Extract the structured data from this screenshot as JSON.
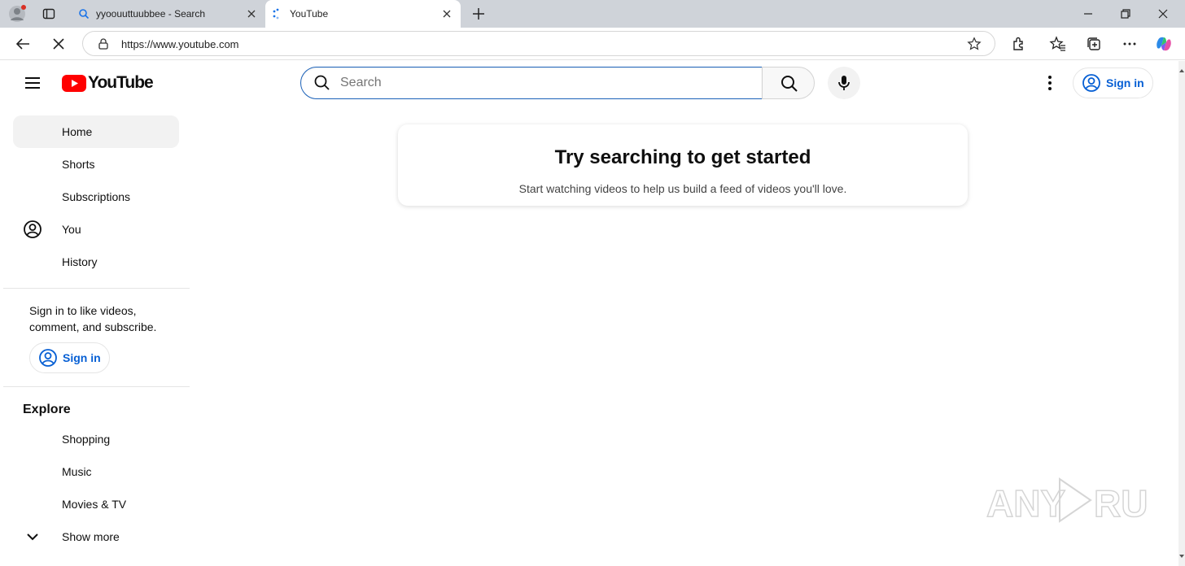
{
  "browser": {
    "tabs": [
      {
        "title": "yyoouuttuubbee - Search",
        "icon": "search-icon"
      },
      {
        "title": "YouTube",
        "icon": "loading-icon",
        "active": true
      }
    ],
    "url": "https://www.youtube.com"
  },
  "youtube": {
    "logo_text": "YouTube",
    "search_placeholder": "Search",
    "sign_in_label": "Sign in",
    "sidebar": {
      "main_items": [
        {
          "label": "Home",
          "active": true
        },
        {
          "label": "Shorts"
        },
        {
          "label": "Subscriptions"
        },
        {
          "label": "You",
          "icon": "account-circle-icon"
        },
        {
          "label": "History"
        }
      ],
      "sign_in_prompt_line1": "Sign in to like videos,",
      "sign_in_prompt_line2": "comment, and subscribe.",
      "sign_in_button": "Sign in",
      "explore_heading": "Explore",
      "explore_items": [
        {
          "label": "Shopping"
        },
        {
          "label": "Music"
        },
        {
          "label": "Movies & TV"
        },
        {
          "label": "Show more",
          "icon": "chevron-down-icon"
        }
      ]
    },
    "empty_state": {
      "title": "Try searching to get started",
      "subtitle": "Start watching videos to help us build a feed of videos you'll love."
    }
  },
  "watermark": "ANY RUN",
  "colors": {
    "brand_red": "#ff0000",
    "link_blue": "#065fd4",
    "focus_blue": "#1c62b9"
  }
}
